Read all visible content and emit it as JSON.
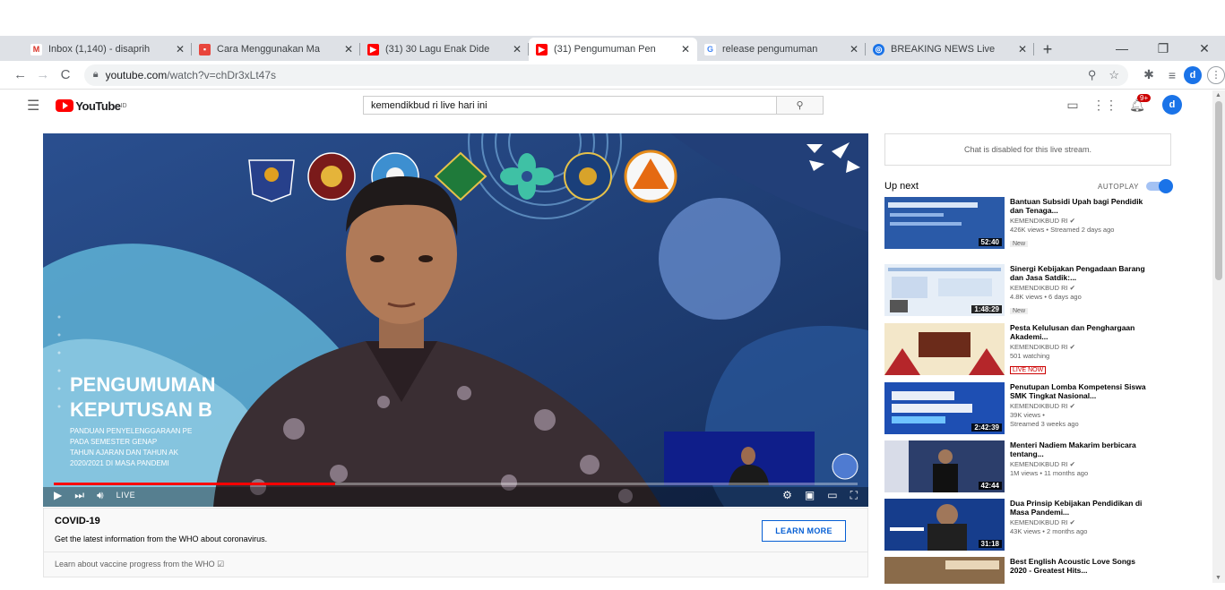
{
  "browser": {
    "tabs": [
      {
        "title": "Inbox (1,140) - disaprih",
        "favicon": "gmail-icon",
        "color": "#d93025"
      },
      {
        "title": "Cara Menggunakan Ma",
        "favicon": "doc-icon",
        "color": "#e8453c"
      },
      {
        "title": "(31) 30 Lagu Enak Dide",
        "favicon": "youtube-icon",
        "color": "#ff0000"
      },
      {
        "title": "(31) Pengumuman Pen",
        "favicon": "youtube-icon",
        "color": "#ff0000",
        "active": true
      },
      {
        "title": "release pengumuman",
        "favicon": "google-icon",
        "color": "#4285f4"
      },
      {
        "title": "BREAKING NEWS Live",
        "favicon": "globe-icon",
        "color": "#1a73e8"
      }
    ],
    "url_host": "youtube.com",
    "url_path": "/watch?v=chDr3xLt47s",
    "profile_initial": "d"
  },
  "youtube": {
    "logo_text": "YouTube",
    "search_value": "kemendikbud ri live hari ini",
    "profile_initial": "d",
    "notif_count": "9+"
  },
  "player": {
    "slide_title_1": "PENGUMUMAN",
    "slide_title_2": "KEPUTUSAN B",
    "slide_lines": [
      "PANDUAN PENYELENGGARAAN PE",
      "PADA SEMESTER GENAP",
      "TAHUN AJARAN DAN TAHUN AK",
      "2020/2021 DI MASA PANDEMI"
    ],
    "live_label": "LIVE",
    "progress_fraction": 0.35
  },
  "info": {
    "heading": "COVID-19",
    "description": "Get the latest information from the WHO about coronavirus.",
    "button": "LEARN MORE",
    "vaccine_link": "Learn about vaccine progress from the WHO ☑"
  },
  "sidebar": {
    "chat_disabled": "Chat is disabled for this live stream.",
    "up_next": "Up next",
    "autoplay": "AUTOPLAY",
    "autoplay_on": true,
    "recommendations": [
      {
        "title": "Bantuan Subsidi Upah bagi Pendidik dan Tenaga...",
        "channel": "KEMENDIKBUD RI ✔",
        "views": "426K views • Streamed 2 days ago",
        "badge": "New",
        "duration": "52:40",
        "thumb_color": "#2a5aa8"
      },
      {
        "title": "Sinergi Kebijakan Pengadaan Barang dan Jasa Satdik:...",
        "channel": "KEMENDIKBUD RI ✔",
        "views": "4.8K views • 6 days ago",
        "badge": "New",
        "duration": "1:48:29",
        "thumb_color": "#dfe9f5"
      },
      {
        "title": "Pesta Kelulusan dan Penghargaan Akademi...",
        "channel": "KEMENDIKBUD RI ✔",
        "views": "501 watching",
        "live_badge": "LIVE NOW",
        "duration": "",
        "thumb_color": "#f3e7c9"
      },
      {
        "title": "Penutupan Lomba Kompetensi Siswa SMK Tingkat Nasional...",
        "channel": "KEMENDIKBUD RI ✔",
        "views": "39K views •",
        "views2": "Streamed 3 weeks ago",
        "duration": "2:42:39",
        "thumb_color": "#1e4fb3"
      },
      {
        "title": "Menteri Nadiem Makarim berbicara tentang...",
        "channel": "KEMENDIKBUD RI ✔",
        "views": "1M views • 11 months ago",
        "duration": "42:44",
        "thumb_color": "#2c3e6b"
      },
      {
        "title": "Dua Prinsip Kebijakan Pendidikan di Masa Pandemi...",
        "channel": "KEMENDIKBUD RI ✔",
        "views": "43K views • 2 months ago",
        "duration": "31:18",
        "thumb_color": "#163d8c"
      },
      {
        "title": "Best English Acoustic Love Songs 2020 - Greatest Hits...",
        "channel": "",
        "views": "",
        "duration": "",
        "thumb_color": "#8a6b4a"
      }
    ]
  }
}
